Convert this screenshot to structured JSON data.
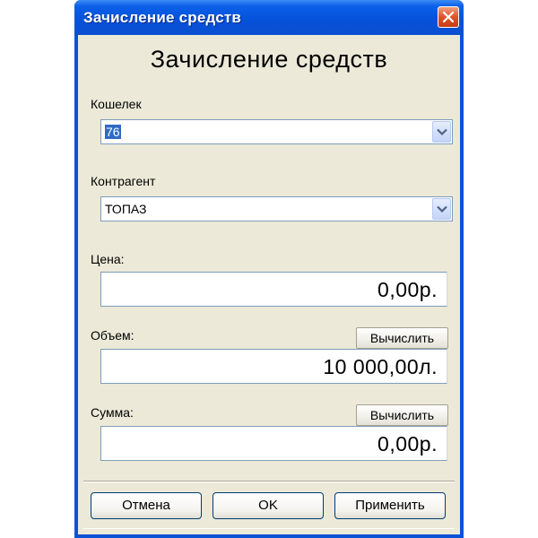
{
  "window": {
    "title": "Зачисление средств"
  },
  "form": {
    "heading": "Зачисление средств",
    "wallet": {
      "label": "Кошелек",
      "value": "76"
    },
    "counterparty": {
      "label": "Контрагент",
      "value": "ТОПАЗ"
    },
    "price": {
      "label": "Цена:",
      "value": "0,00р."
    },
    "volume": {
      "label": "Объем:",
      "value": "10 000,00л.",
      "calc_label": "Вычислить"
    },
    "sum": {
      "label": "Сумма:",
      "value": "0,00р.",
      "calc_label": "Вычислить"
    }
  },
  "buttons": {
    "cancel": "Отмена",
    "ok": "OK",
    "apply": "Применить"
  },
  "colors": {
    "titlebar": "#0651d9",
    "client": "#ece9d8",
    "selection": "#316ac5",
    "close": "#e0522a"
  },
  "icons": {
    "close": "close-icon",
    "dropdown": "chevron-down-icon"
  }
}
